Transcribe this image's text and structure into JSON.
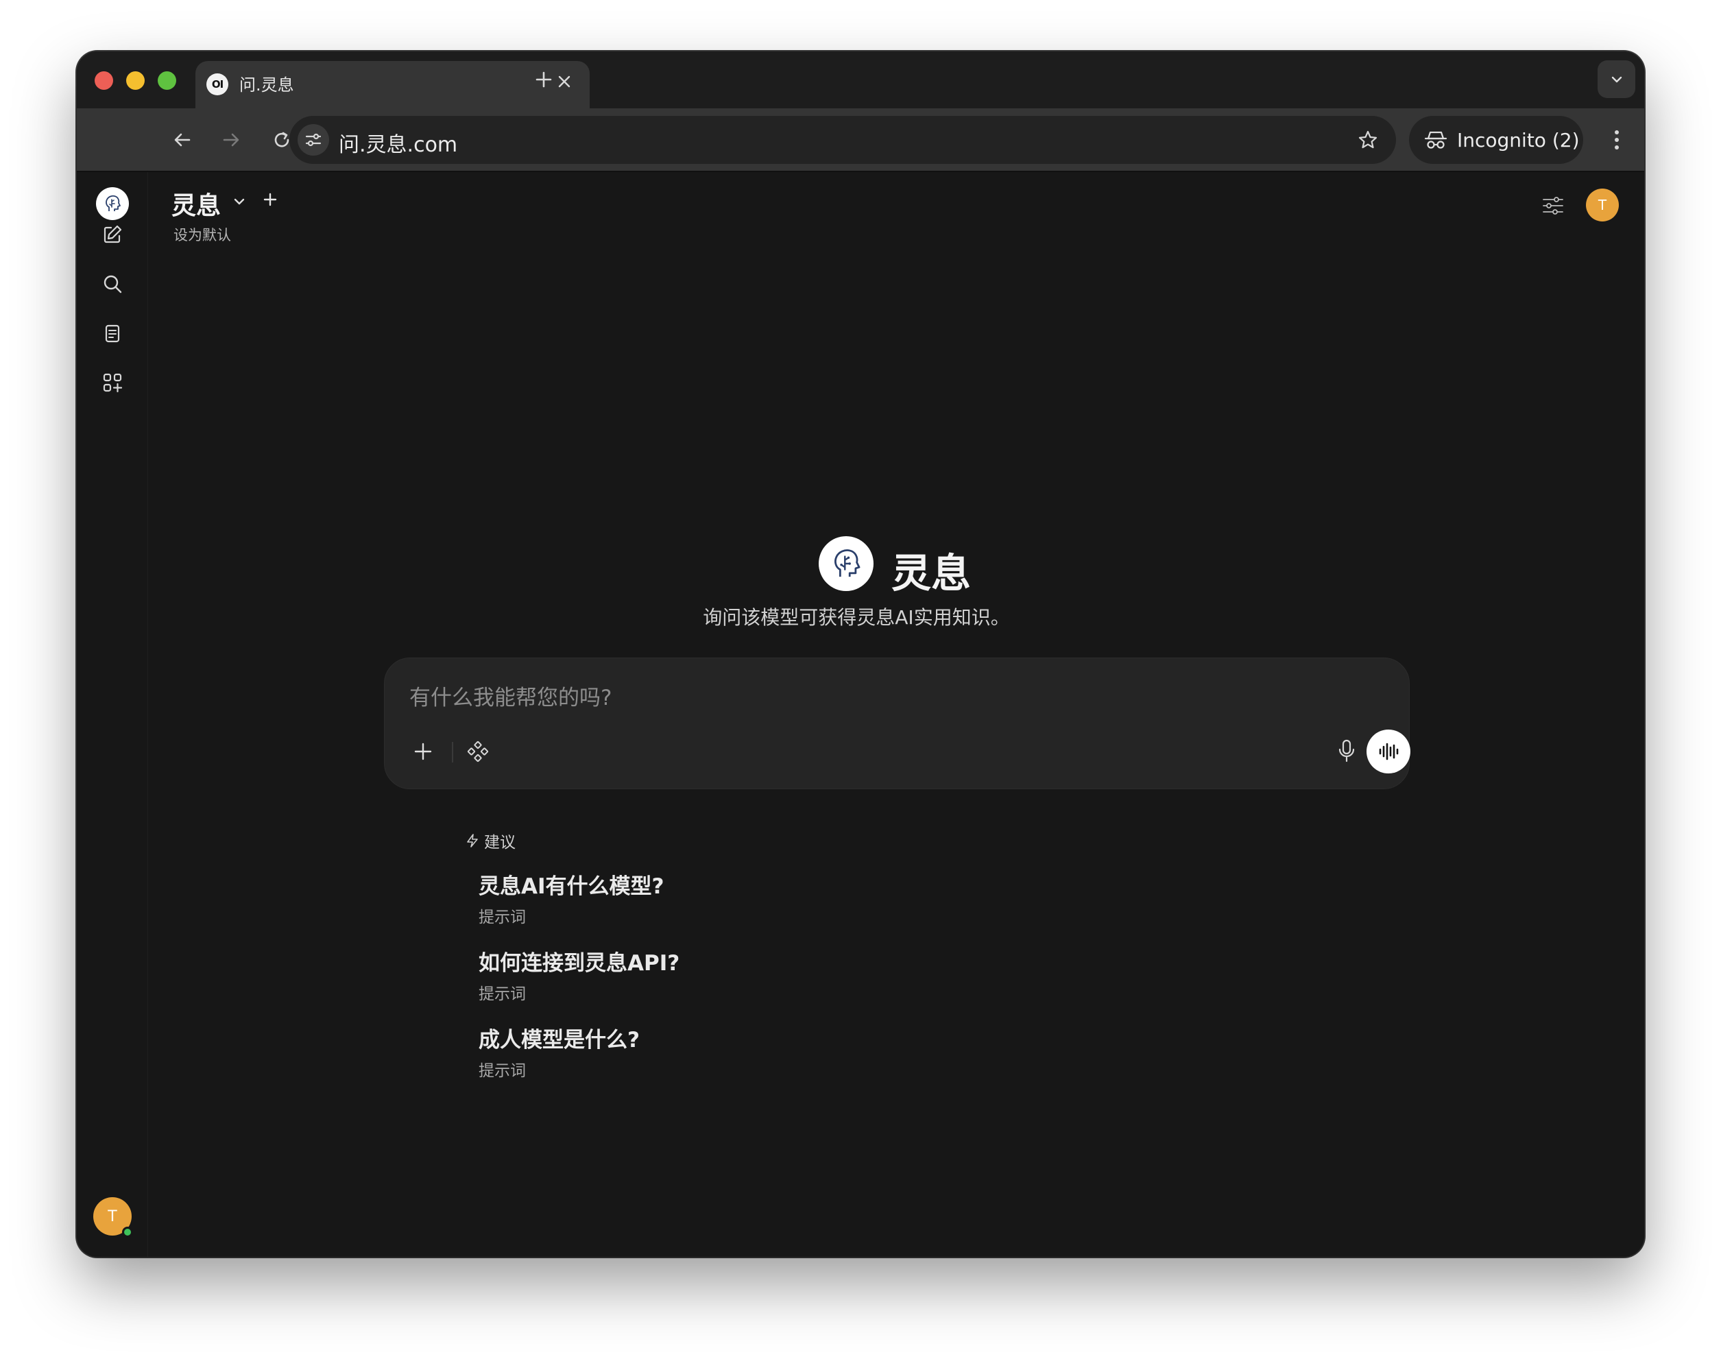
{
  "browser": {
    "tab_title": "问.灵息",
    "tab_favicon_text": "OI",
    "url": "问.灵息.com",
    "incognito_label": "Incognito (2)"
  },
  "app": {
    "model_name": "灵息",
    "set_default_label": "设为默认",
    "avatar_initial": "T",
    "hero_title": "灵息",
    "hero_subtitle": "询问该模型可获得灵息AI实用知识。",
    "input_placeholder": "有什么我能帮您的吗?",
    "suggestions_header": "建议",
    "suggestions": [
      {
        "title": "灵息AI有什么模型?",
        "subtitle": "提示词"
      },
      {
        "title": "如何连接到灵息API?",
        "subtitle": "提示词"
      },
      {
        "title": "成人模型是什么?",
        "subtitle": "提示词"
      }
    ]
  },
  "colors": {
    "app_background": "#171717",
    "avatar": "#e8a33c",
    "online": "#3fc25a"
  }
}
